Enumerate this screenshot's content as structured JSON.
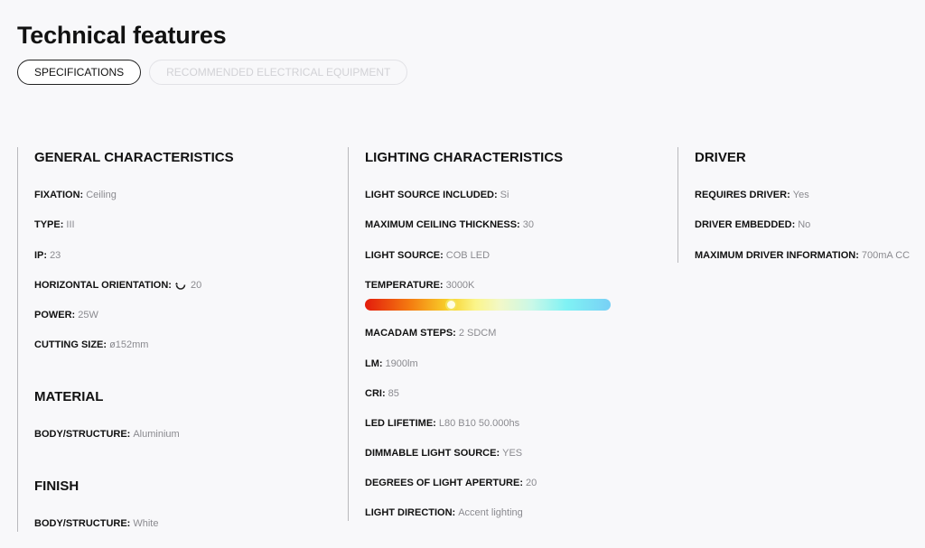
{
  "page_title": "Technical features",
  "tabs": [
    {
      "label": "SPECIFICATIONS",
      "active": true
    },
    {
      "label": "RECOMMENDED ELECTRICAL EQUIPMENT",
      "active": false
    }
  ],
  "general": {
    "title": "GENERAL CHARACTERISTICS",
    "rows": [
      {
        "key": "FIXATION:",
        "value": "Ceiling"
      },
      {
        "key": "TYPE:",
        "value": "III"
      },
      {
        "key": "IP:",
        "value": "23"
      },
      {
        "key": "HORIZONTAL ORIENTATION:",
        "value": "20",
        "icon": "rotate-icon"
      },
      {
        "key": "POWER:",
        "value": "25W"
      },
      {
        "key": "CUTTING SIZE:",
        "value": "ø152mm"
      }
    ]
  },
  "material": {
    "title": "MATERIAL",
    "rows": [
      {
        "key": "BODY/STRUCTURE:",
        "value": "Aluminium"
      }
    ]
  },
  "finish": {
    "title": "FINISH",
    "rows": [
      {
        "key": "BODY/STRUCTURE:",
        "value": "White"
      }
    ]
  },
  "lighting": {
    "title": "LIGHTING CHARACTERISTICS",
    "rows": [
      {
        "key": "LIGHT SOURCE INCLUDED:",
        "value": "Si"
      },
      {
        "key": "MAXIMUM CEILING THICKNESS:",
        "value": "30"
      },
      {
        "key": "LIGHT SOURCE:",
        "value": "COB LED"
      },
      {
        "key": "TEMPERATURE:",
        "value": "3000K"
      },
      {
        "key": "MACADAM STEPS:",
        "value": "2 SDCM"
      },
      {
        "key": "LM:",
        "value": "1900lm"
      },
      {
        "key": "CRI:",
        "value": "85"
      },
      {
        "key": "LED LIFETIME:",
        "value": "L80 B10 50.000hs"
      },
      {
        "key": "DIMMABLE LIGHT SOURCE:",
        "value": "YES"
      },
      {
        "key": "DEGREES OF LIGHT APERTURE:",
        "value": "20"
      },
      {
        "key": "LIGHT DIRECTION:",
        "value": "Accent lighting"
      }
    ],
    "temperature_slider_fraction": 0.35
  },
  "driver": {
    "title": "DRIVER",
    "rows": [
      {
        "key": "REQUIRES DRIVER:",
        "value": "Yes"
      },
      {
        "key": "DRIVER EMBEDDED:",
        "value": "No"
      },
      {
        "key": "MAXIMUM DRIVER INFORMATION:",
        "value": "700mA CC"
      }
    ]
  }
}
